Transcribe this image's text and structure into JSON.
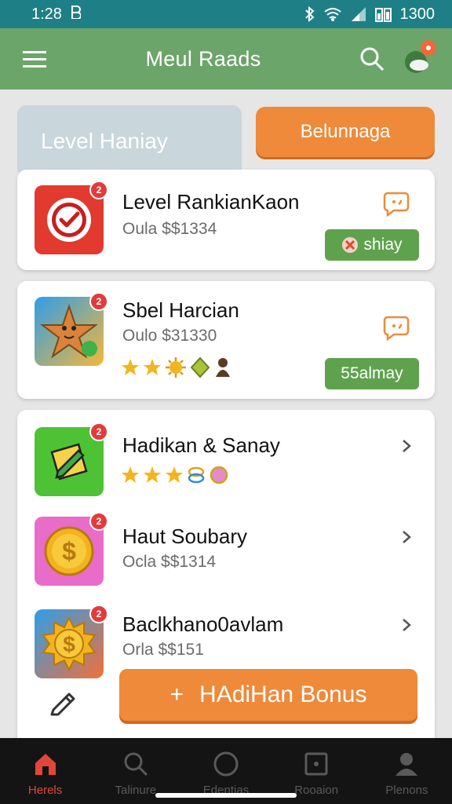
{
  "status_bar": {
    "time": "1:28",
    "battery_text": "1300"
  },
  "header": {
    "title": "Meul Raads"
  },
  "top": {
    "level_label": "Level Haniay",
    "balance_label": "Belunnaga"
  },
  "cards": [
    {
      "title": "Level RankianKaon",
      "subtitle": "Oula $$1334",
      "button": "shiay",
      "icon": "check-badge-icon"
    },
    {
      "title": "Sbel Harcian",
      "subtitle": "Oulo $31330",
      "button": "55almay",
      "icon": "star-character-icon"
    }
  ],
  "list": [
    {
      "title": "Hadikan & Sanay",
      "icon": "note-pencil-icon"
    },
    {
      "title": "Haut Soubary",
      "subtitle": "Ocla $$1314",
      "icon": "dollar-coin-icon"
    },
    {
      "title": "Baclkhano0avlam",
      "subtitle": "Orla $$151",
      "icon": "sun-coin-icon"
    }
  ],
  "bonus": {
    "plus": "+",
    "label": "HAdiHan Bonus"
  },
  "nav": [
    {
      "label": "Herels",
      "icon": "home-icon",
      "active": true
    },
    {
      "label": "Talinure",
      "icon": "search-icon",
      "active": false
    },
    {
      "label": "Edentias",
      "icon": "circle-icon",
      "active": false
    },
    {
      "label": "Rooaion",
      "icon": "square-icon",
      "active": false
    },
    {
      "label": "Plenons",
      "icon": "profile-icon",
      "active": false
    }
  ],
  "colors": {
    "status_bar": "#1f7f86",
    "header": "#6ca56a",
    "accent_orange": "#ee8a3a",
    "accent_green": "#5fa24e",
    "nav_active": "#e1463a"
  }
}
